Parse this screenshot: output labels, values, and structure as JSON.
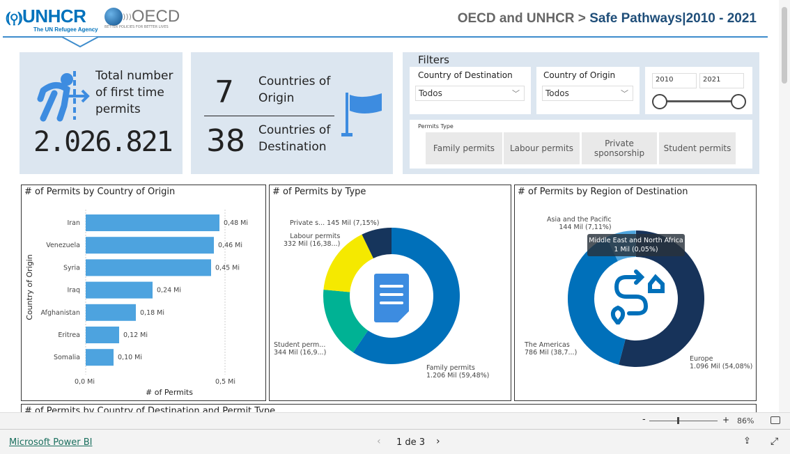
{
  "header": {
    "unhcr_logo": "UNHCR",
    "unhcr_tagline": "The UN Refugee Agency",
    "oecd_logo": "OECD",
    "oecd_tagline": "BETTER POLICIES FOR BETTER LIVES",
    "title_prefix": "OECD and UNHCR > ",
    "title_main": "Safe Pathways|2010 - 2021"
  },
  "kpi": {
    "total_label": "Total number of first time permits",
    "total_value": "2.026.821",
    "origin_value": "7",
    "origin_label": "Countries of Origin",
    "dest_value": "38",
    "dest_label": "Countries of Destination",
    "icons": [
      "person-crossing-icon",
      "flag-icon"
    ]
  },
  "filters": {
    "title": "Filters",
    "destination": {
      "label": "Country of Destination",
      "value": "Todos"
    },
    "origin": {
      "label": "Country of Origin",
      "value": "Todos"
    },
    "year": {
      "from": "2010",
      "to": "2021"
    },
    "permits_type": {
      "label": "Permits Type",
      "options": [
        "Family permits",
        "Labour permits",
        "Private sponsorship",
        "Student permits"
      ]
    }
  },
  "chart_data": [
    {
      "type": "bar",
      "title": "# of Permits by Country of Origin",
      "xlabel": "# of Permits",
      "ylabel": "Country of Origin",
      "categories": [
        "Iran",
        "Venezuela",
        "Syria",
        "Iraq",
        "Afghanistan",
        "Eritrea",
        "Somalia"
      ],
      "values": [
        0.48,
        0.46,
        0.45,
        0.24,
        0.18,
        0.12,
        0.1
      ],
      "value_labels": [
        "0,48 Mi",
        "0,46 Mi",
        "0,45 Mi",
        "0,24 Mi",
        "0,18 Mi",
        "0,12 Mi",
        "0,10 Mi"
      ],
      "xticks": [
        "0,0 Mi",
        "0,5 Mi"
      ],
      "xlim": [
        0,
        0.5
      ],
      "color": "#4da3df"
    },
    {
      "type": "pie",
      "donut": true,
      "title": "# of Permits by Type",
      "categories": [
        "Family permits",
        "Student permits",
        "Labour permits",
        "Private sponsorship"
      ],
      "values": [
        1206,
        344,
        332,
        145
      ],
      "labels": [
        [
          "Family permits",
          "1.206 Mil (59,48%)"
        ],
        [
          "Student perm...",
          "344 Mil (16,9...)"
        ],
        [
          "Labour permits",
          "332 Mil (16,38...)"
        ],
        [
          "Private s... 145 Mil (7,15%)",
          ""
        ]
      ],
      "colors": [
        "#0070ba",
        "#00b294",
        "#f5e900",
        "#16355c"
      ]
    },
    {
      "type": "pie",
      "donut": true,
      "title": "# of Permits by Region of Destination",
      "categories": [
        "Europe",
        "The Americas",
        "Asia and the Pacific",
        "Middle East and North Africa"
      ],
      "values": [
        1096,
        786,
        144,
        1
      ],
      "labels": [
        [
          "Europe",
          "1.096 Mil (54,08%)"
        ],
        [
          "The Americas",
          "786 Mil (38,7...)"
        ],
        [
          "Asia and the Pacific",
          "144 Mil (7,11%)"
        ]
      ],
      "colors": [
        "#17335a",
        "#0070ba",
        "#4fa6df",
        "#9fd0f0"
      ],
      "tooltip": [
        "Middle East and North Africa",
        "1 Mil (0,05%)"
      ]
    }
  ],
  "next_panel_title": "# of Permits by Country of Destination and Permit Type",
  "zoom": {
    "minus": "-",
    "plus": "+",
    "level": "86%"
  },
  "footer": {
    "brand": "Microsoft Power BI",
    "page": "1 de 3"
  }
}
